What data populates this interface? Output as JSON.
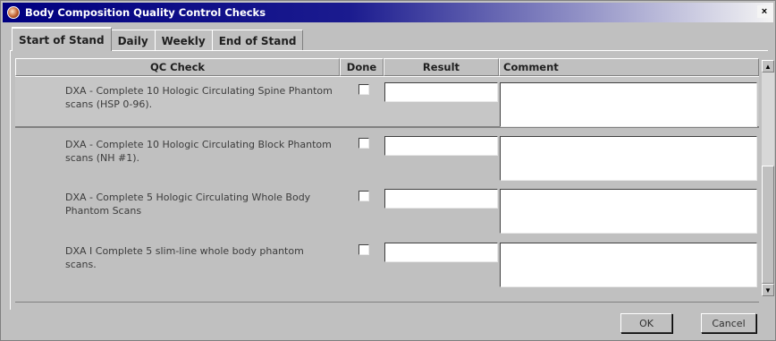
{
  "window": {
    "title": "Body Composition Quality Control Checks",
    "close_glyph": "×"
  },
  "tabs": [
    {
      "label": "Start of Stand",
      "active": true
    },
    {
      "label": "Daily",
      "active": false
    },
    {
      "label": "Weekly",
      "active": false
    },
    {
      "label": "End of Stand",
      "active": false
    }
  ],
  "grid": {
    "columns": {
      "qc_check": "QC Check",
      "done": "Done",
      "result": "Result",
      "comment": "Comment"
    },
    "rows": [
      {
        "qc_check": "DXA - Complete 10 Hologic Circulating Spine Phantom scans (HSP 0-96).",
        "done": false,
        "result": "",
        "comment": ""
      },
      {
        "qc_check": "DXA - Complete 10 Hologic Circulating Block Phantom scans (NH #1).",
        "done": false,
        "result": "",
        "comment": ""
      },
      {
        "qc_check": "DXA - Complete 5 Hologic Circulating Whole Body Phantom Scans",
        "done": false,
        "result": "",
        "comment": ""
      },
      {
        "qc_check": "DXA I Complete 5 slim-line whole body phantom scans.",
        "done": false,
        "result": "",
        "comment": ""
      }
    ]
  },
  "scrollbar": {
    "up_icon": "▲",
    "down_icon": "▼"
  },
  "buttons": {
    "ok": "OK",
    "cancel": "Cancel"
  }
}
